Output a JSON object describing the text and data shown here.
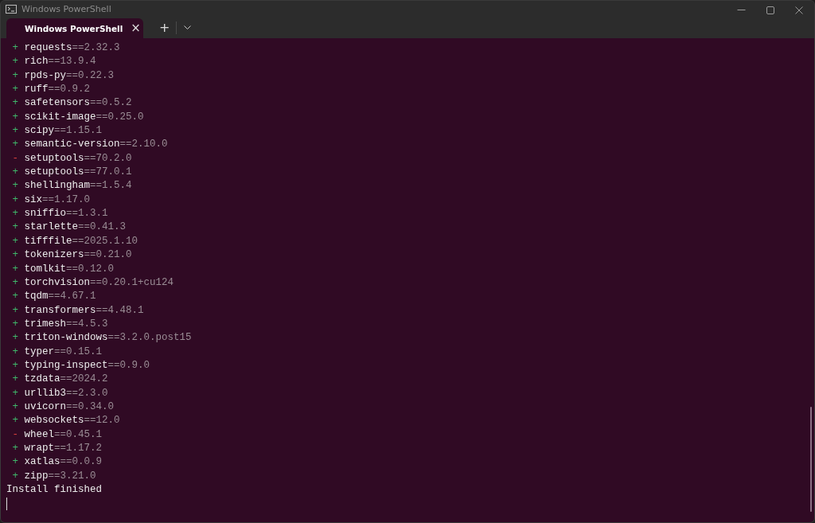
{
  "window": {
    "title": "Windows PowerShell"
  },
  "tabs": [
    {
      "label": "Windows PowerShell",
      "selected": true,
      "close": "×"
    }
  ],
  "tab_actions": {
    "new_tab": "+"
  },
  "terminal": {
    "lines": [
      {
        "kind": "added",
        "sign": "+",
        "name": "requests",
        "version": "==2.32.3"
      },
      {
        "kind": "added",
        "sign": "+",
        "name": "rich",
        "version": "==13.9.4"
      },
      {
        "kind": "added",
        "sign": "+",
        "name": "rpds-py",
        "version": "==0.22.3"
      },
      {
        "kind": "added",
        "sign": "+",
        "name": "ruff",
        "version": "==0.9.2"
      },
      {
        "kind": "added",
        "sign": "+",
        "name": "safetensors",
        "version": "==0.5.2"
      },
      {
        "kind": "added",
        "sign": "+",
        "name": "scikit-image",
        "version": "==0.25.0"
      },
      {
        "kind": "added",
        "sign": "+",
        "name": "scipy",
        "version": "==1.15.1"
      },
      {
        "kind": "added",
        "sign": "+",
        "name": "semantic-version",
        "version": "==2.10.0"
      },
      {
        "kind": "removed",
        "sign": "-",
        "name": "setuptools",
        "version": "==70.2.0"
      },
      {
        "kind": "added",
        "sign": "+",
        "name": "setuptools",
        "version": "==77.0.1"
      },
      {
        "kind": "added",
        "sign": "+",
        "name": "shellingham",
        "version": "==1.5.4"
      },
      {
        "kind": "added",
        "sign": "+",
        "name": "six",
        "version": "==1.17.0"
      },
      {
        "kind": "added",
        "sign": "+",
        "name": "sniffio",
        "version": "==1.3.1"
      },
      {
        "kind": "added",
        "sign": "+",
        "name": "starlette",
        "version": "==0.41.3"
      },
      {
        "kind": "added",
        "sign": "+",
        "name": "tifffile",
        "version": "==2025.1.10"
      },
      {
        "kind": "added",
        "sign": "+",
        "name": "tokenizers",
        "version": "==0.21.0"
      },
      {
        "kind": "added",
        "sign": "+",
        "name": "tomlkit",
        "version": "==0.12.0"
      },
      {
        "kind": "added",
        "sign": "+",
        "name": "torchvision",
        "version": "==0.20.1+cu124"
      },
      {
        "kind": "added",
        "sign": "+",
        "name": "tqdm",
        "version": "==4.67.1"
      },
      {
        "kind": "added",
        "sign": "+",
        "name": "transformers",
        "version": "==4.48.1"
      },
      {
        "kind": "added",
        "sign": "+",
        "name": "trimesh",
        "version": "==4.5.3"
      },
      {
        "kind": "added",
        "sign": "+",
        "name": "triton-windows",
        "version": "==3.2.0.post15"
      },
      {
        "kind": "added",
        "sign": "+",
        "name": "typer",
        "version": "==0.15.1"
      },
      {
        "kind": "added",
        "sign": "+",
        "name": "typing-inspect",
        "version": "==0.9.0"
      },
      {
        "kind": "added",
        "sign": "+",
        "name": "tzdata",
        "version": "==2024.2"
      },
      {
        "kind": "added",
        "sign": "+",
        "name": "urllib3",
        "version": "==2.3.0"
      },
      {
        "kind": "added",
        "sign": "+",
        "name": "uvicorn",
        "version": "==0.34.0"
      },
      {
        "kind": "added",
        "sign": "+",
        "name": "websockets",
        "version": "==12.0"
      },
      {
        "kind": "removed",
        "sign": "-",
        "name": "wheel",
        "version": "==0.45.1"
      },
      {
        "kind": "added",
        "sign": "+",
        "name": "wrapt",
        "version": "==1.17.2"
      },
      {
        "kind": "added",
        "sign": "+",
        "name": "xatlas",
        "version": "==0.0.9"
      },
      {
        "kind": "added",
        "sign": "+",
        "name": "zipp",
        "version": "==3.21.0"
      },
      {
        "kind": "message",
        "text": "Install finished"
      }
    ]
  }
}
